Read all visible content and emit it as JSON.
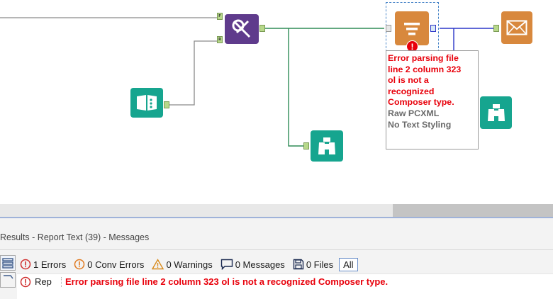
{
  "canvas": {
    "tools": [
      {
        "name": "formula-tool",
        "icon": "formula-tool-icon",
        "color": "#5f3b8c"
      },
      {
        "name": "browse-input-tool",
        "icon": "open-book-icon",
        "color": "#16a58f"
      },
      {
        "name": "report-text-tool",
        "icon": "report-text-icon",
        "color": "#d8883d"
      },
      {
        "name": "email-tool",
        "icon": "envelope-icon",
        "color": "#d8883d"
      },
      {
        "name": "browse-tool-bottom",
        "icon": "binoculars-icon",
        "color": "#16a58f"
      },
      {
        "name": "browse-tool-right",
        "icon": "binoculars-icon",
        "color": "#16a58f"
      }
    ],
    "anchors": {
      "f_label": "F",
      "r_label": "R"
    },
    "error_tooltip": {
      "error_text": "Error parsing file\nline 2 column 323\nol is not a\nrecognized\nComposer type.",
      "meta_lines": [
        "Raw PCXML",
        "No Text Styling"
      ]
    }
  },
  "results": {
    "title": "Results - Report Text (39) - Messages",
    "filters": [
      {
        "label": "1 Errors",
        "icon": "error-circle-icon"
      },
      {
        "label": "0 Conv Errors",
        "icon": "conversion-error-icon"
      },
      {
        "label": "0 Warnings",
        "icon": "warning-triangle-icon"
      },
      {
        "label": "0 Messages",
        "icon": "message-bubble-icon"
      },
      {
        "label": "0 Files",
        "icon": "file-save-icon"
      },
      {
        "label": "All",
        "icon": ""
      }
    ],
    "message": {
      "tool": "Rep",
      "text": "Error parsing file line 2 column 323 ol is not a recognized Composer type."
    }
  },
  "colors": {
    "error_red": "#e8000b",
    "wire_green": "#2e8b57",
    "wire_blue": "#2c36c8",
    "wire_gray": "#8a8a8a"
  }
}
